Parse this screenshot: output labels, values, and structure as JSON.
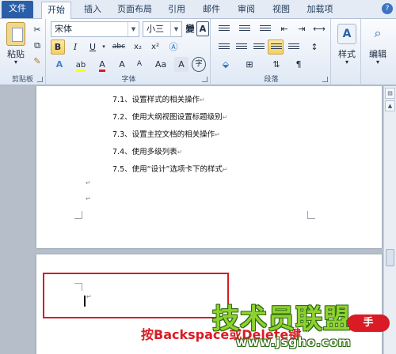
{
  "tabs": [
    {
      "label": "文件"
    },
    {
      "label": "开始"
    },
    {
      "label": "插入"
    },
    {
      "label": "页面布局"
    },
    {
      "label": "引用"
    },
    {
      "label": "邮件"
    },
    {
      "label": "审阅"
    },
    {
      "label": "视图"
    },
    {
      "label": "加载项"
    }
  ],
  "ribbon": {
    "clipboard": {
      "paste_label": "粘贴",
      "group_label": "剪贴板"
    },
    "font": {
      "font_name": "宋体",
      "font_size": "小三",
      "group_label": "字体",
      "bold": "B",
      "italic": "I",
      "underline": "U",
      "strike": "abc",
      "subscript": "x₂",
      "superscript": "x²",
      "grow": "A",
      "shrink": "A",
      "case": "Aa",
      "clear": "A",
      "phonetic": "變",
      "border_char": "A"
    },
    "paragraph": {
      "group_label": "段落"
    },
    "styles": {
      "label": "样式"
    },
    "editing": {
      "label": "编辑"
    }
  },
  "document": {
    "lines": [
      "7.1、设置样式的相关操作",
      "7.2、使用大纲视图设置标题级别",
      "7.3、设置主控文档的相关操作",
      "7.4、使用多级列表",
      "7.5、使用“设计”选项卡下的样式"
    ],
    "paragraph_mark": "↵",
    "caret_mark": "↵"
  },
  "overlay": {
    "caption": "按Backspace或Delete键",
    "pill": "手",
    "logo": "技术员联盟",
    "url": "www.jsgho.com"
  },
  "colors": {
    "accent": "#2a5fa8",
    "highlight": "#d81b24",
    "logo_green": "#8fd12e"
  },
  "icons": {
    "help": "help-icon",
    "scroll_up": "arrow-up-icon",
    "ruler": "ruler-icon"
  }
}
